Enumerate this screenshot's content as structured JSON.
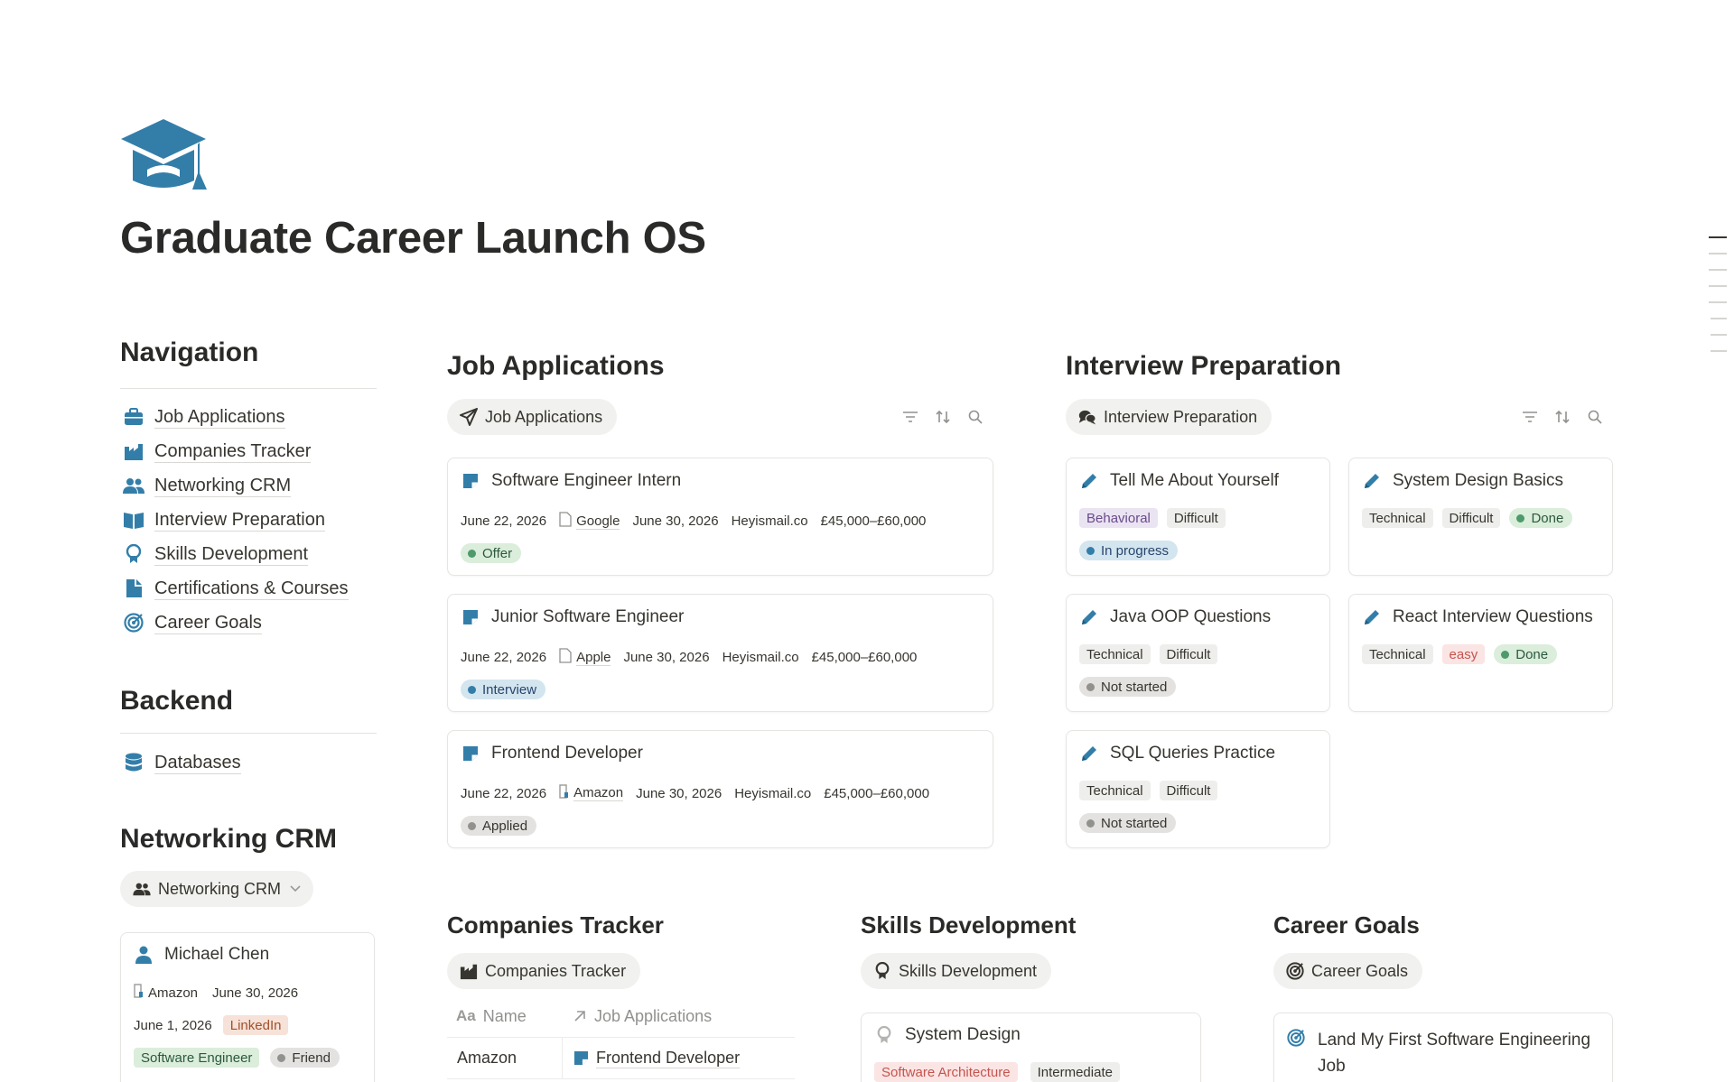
{
  "page": {
    "icon": "graduation-cap-icon",
    "title": "Graduate Career Launch OS",
    "accent": "#337ea9"
  },
  "navigation": {
    "heading": "Navigation",
    "items": [
      {
        "label": "Job Applications",
        "icon": "briefcase-icon"
      },
      {
        "label": "Companies Tracker",
        "icon": "factory-icon"
      },
      {
        "label": "Networking CRM",
        "icon": "people-icon"
      },
      {
        "label": "Interview Preparation",
        "icon": "open-book-icon"
      },
      {
        "label": "Skills Development",
        "icon": "brain-icon"
      },
      {
        "label": "Certifications & Courses",
        "icon": "document-icon"
      },
      {
        "label": "Career Goals",
        "icon": "target-icon"
      }
    ]
  },
  "backend": {
    "heading": "Backend",
    "items": [
      {
        "label": "Databases",
        "icon": "database-icon"
      }
    ]
  },
  "networking": {
    "heading": "Networking CRM",
    "view_label": "Networking CRM",
    "card": {
      "name": "Michael Chen",
      "company": "Amazon",
      "date1": "June 30, 2026",
      "date2": "June 1, 2026",
      "source": "LinkedIn",
      "role": "Software Engineer",
      "relation": "Friend"
    }
  },
  "job_applications": {
    "heading": "Job Applications",
    "view_label": "Job Applications",
    "cards": [
      {
        "title": "Software Engineer Intern",
        "date": "June 22, 2026",
        "company": "Google",
        "company_icon": "page-icon",
        "deadline": "June 30, 2026",
        "email": "Heyismail.co",
        "salary": "£45,000–£60,000",
        "status": "Offer"
      },
      {
        "title": "Junior Software Engineer",
        "date": "June 22, 2026",
        "company": "Apple",
        "company_icon": "page-icon",
        "deadline": "June 30, 2026",
        "email": "Heyismail.co",
        "salary": "£45,000–£60,000",
        "status": "Interview"
      },
      {
        "title": "Frontend Developer",
        "date": "June 22, 2026",
        "company": "Amazon",
        "company_icon": "building-icon",
        "deadline": "June 30, 2026",
        "email": "Heyismail.co",
        "salary": "£45,000–£60,000",
        "status": "Applied"
      }
    ]
  },
  "interview_prep": {
    "heading": "Interview Preparation",
    "view_label": "Interview Preparation",
    "cards": [
      {
        "title": "Tell Me About Yourself",
        "type": "Behavioral",
        "difficulty": "Difficult",
        "status": "In progress"
      },
      {
        "title": "System Design Basics",
        "type": "Technical",
        "difficulty": "Difficult",
        "status": "Done"
      },
      {
        "title": "Java OOP Questions",
        "type": "Technical",
        "difficulty": "Difficult",
        "status": "Not started"
      },
      {
        "title": "React Interview Questions",
        "type": "Technical",
        "difficulty": "easy",
        "status": "Done"
      },
      {
        "title": "SQL Queries Practice",
        "type": "Technical",
        "difficulty": "Difficult",
        "status": "Not started"
      }
    ]
  },
  "companies": {
    "heading": "Companies Tracker",
    "view_label": "Companies Tracker",
    "columns": [
      "Name",
      "Job Applications"
    ],
    "rows": [
      {
        "name": "Amazon",
        "job": "Frontend Developer"
      }
    ]
  },
  "skills": {
    "heading": "Skills Development",
    "view_label": "Skills Development",
    "card": {
      "title": "System Design",
      "area": "Software Architecture",
      "level": "Intermediate"
    }
  },
  "goals": {
    "heading": "Career Goals",
    "view_label": "Career Goals",
    "card": {
      "title_line1": "Land My First Software Engineering",
      "title_line2": "Job"
    }
  }
}
